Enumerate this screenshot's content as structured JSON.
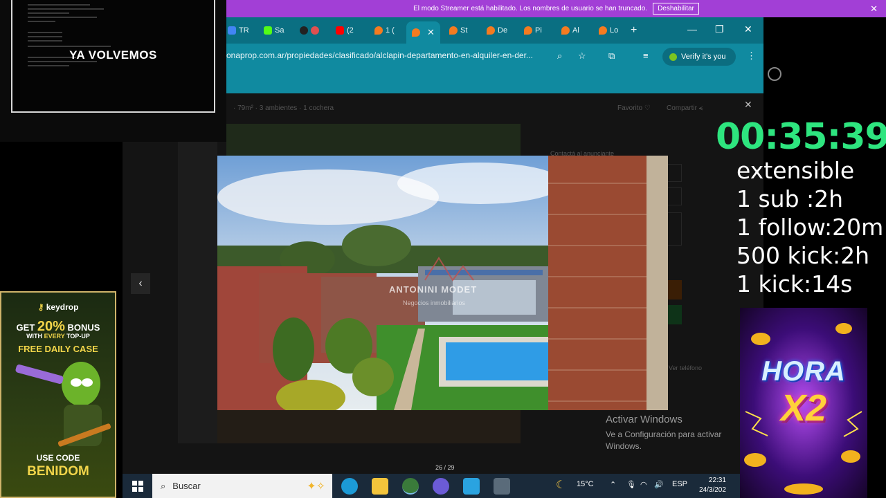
{
  "streamer_banner": {
    "message": "El modo Streamer está habilitado. Los nombres de usuario se han truncado.",
    "button": "Deshabilitar",
    "close": "✕"
  },
  "browser": {
    "tabs": [
      {
        "label": "TR",
        "icon": "docs-icon",
        "color": "#4285f4"
      },
      {
        "label": "Sa",
        "icon": "kick-icon",
        "color": "#53fc18"
      },
      {
        "label": "",
        "icon": "extension-icon",
        "color": "#222222"
      },
      {
        "label": "(2",
        "icon": "youtube-icon",
        "color": "#ff0000"
      },
      {
        "label": "1 (",
        "icon": "zonaprop-icon",
        "color": "#f47b20"
      },
      {
        "label": "",
        "icon": "zonaprop-icon",
        "color": "#f47b20",
        "active": true
      },
      {
        "label": "St",
        "icon": "zonaprop-icon",
        "color": "#f47b20"
      },
      {
        "label": "De",
        "icon": "zonaprop-icon",
        "color": "#f47b20"
      },
      {
        "label": "Pi",
        "icon": "zonaprop-icon",
        "color": "#f47b20"
      },
      {
        "label": "Al",
        "icon": "zonaprop-icon",
        "color": "#f47b20"
      },
      {
        "label": "Lo",
        "icon": "zonaprop-icon",
        "color": "#f47b20"
      }
    ],
    "new_tab": "+",
    "url": "onaprop.com.ar/propiedades/clasificado/alclapin-departamento-en-alquiler-en-der...",
    "verify_label": "Verify it's you"
  },
  "listing": {
    "summary": "· 79m² · 3 ambientes · 1 cochera",
    "favorite": "Favorito ♡",
    "share": "Compartir ⪪",
    "contact_title": "Contactá al anunciante",
    "phone_label": "Ver teléfono",
    "counter": "26 / 29",
    "watermark_brand": "ANTONINI MODET",
    "watermark_sub": "Negocios inmobiliarios"
  },
  "windows_activation": {
    "title": "Activar Windows",
    "subtitle": "Ve a Configuración para activar Windows."
  },
  "taskbar": {
    "search_placeholder": "Buscar",
    "temperature": "15°C",
    "language": "ESP",
    "time": "22:31",
    "date": "24/3/202"
  },
  "overlay": {
    "brb": "YA VOLVEMOS",
    "timer": "00:35:39",
    "rules": [
      "extensible",
      "1 sub :2h",
      "1 follow:20m",
      "500 kick:2h",
      "1 kick:14s"
    ]
  },
  "keydrop_ad": {
    "brand": "keydrop",
    "line1_pre": "GET ",
    "line1_pct": "20%",
    "line1_post": " BONUS",
    "line2_pre": "WITH ",
    "line2_hl": "EVERY",
    "line2_post": " TOP-UP",
    "line3": "FREE DAILY CASE",
    "code_title": "USE CODE",
    "code": "BENIDOM"
  },
  "hora_ad": {
    "line1": "HORA",
    "line2": "X2"
  }
}
